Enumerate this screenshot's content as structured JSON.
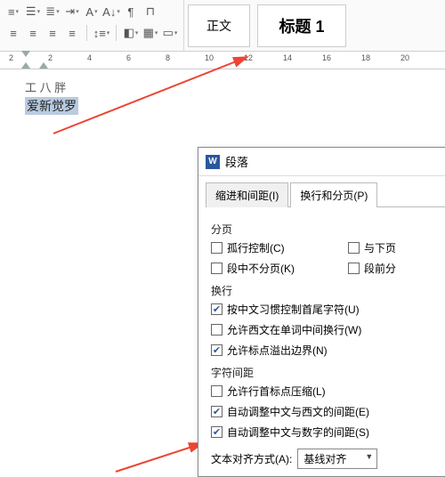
{
  "toolbar": {
    "style_normal": "正文",
    "style_h1": "标题 1"
  },
  "ruler": {
    "ticks": [
      "2",
      "2",
      "4",
      "6",
      "8",
      "10",
      "12",
      "14",
      "16",
      "18",
      "20"
    ]
  },
  "doc": {
    "line1": "工 八 胖",
    "line2": "爱新觉罗"
  },
  "dialog": {
    "title": "段落",
    "icon": "W",
    "tab1": "缩进和间距(I)",
    "tab2": "换行和分页(P)",
    "grp_page": "分页",
    "ck_orphan": "孤行控制(C)",
    "ck_nextpage": "与下页",
    "ck_nobreak": "段中不分页(K)",
    "ck_beforebreak": "段前分",
    "grp_wrap": "换行",
    "ck_cjk": "按中文习惯控制首尾字符(U)",
    "ck_latinwrap": "允许西文在单词中间换行(W)",
    "ck_punct": "允许标点溢出边界(N)",
    "grp_spacing": "字符间距",
    "ck_compress": "允许行首标点压缩(L)",
    "ck_cjklat": "自动调整中文与西文的间距(E)",
    "ck_cjknum": "自动调整中文与数字的间距(S)",
    "align_label": "文本对齐方式(A):",
    "align_value": "基线对齐"
  }
}
